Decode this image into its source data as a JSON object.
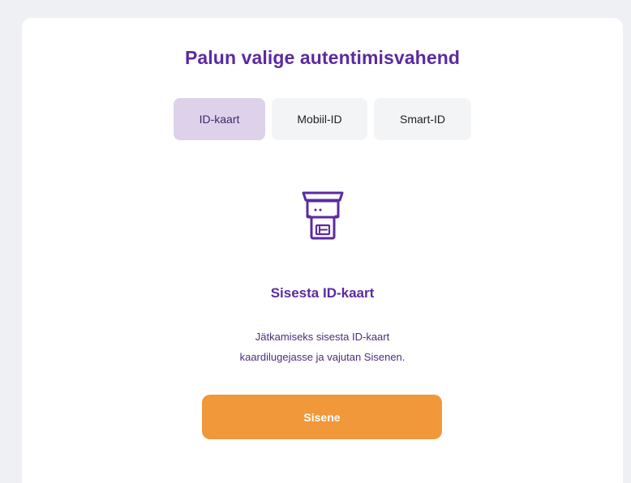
{
  "header": {
    "title": "Palun valige autentimisvahend"
  },
  "tabs": [
    {
      "label": "ID-kaart",
      "active": true
    },
    {
      "label": "Mobiil-ID",
      "active": false
    },
    {
      "label": "Smart-ID",
      "active": false
    }
  ],
  "content": {
    "icon": "id-card-reader-icon",
    "heading": "Sisesta ID-kaart",
    "description_line1": "Jätkamiseks sisesta ID-kaart",
    "description_line2": "kaardilugejasse ja vajutan Sisenen."
  },
  "actions": {
    "submit_label": "Sisene"
  },
  "colors": {
    "accent": "#5b2aa0",
    "tab_active_bg": "#ddd2ea",
    "tab_bg": "#f3f4f6",
    "button": "#f0983a",
    "page_bg": "#eef0f4"
  }
}
